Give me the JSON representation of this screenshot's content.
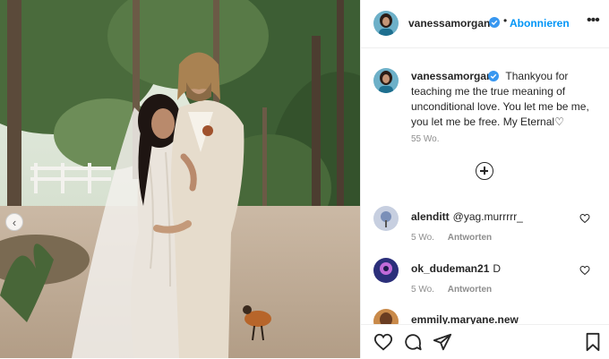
{
  "post": {
    "image_alt": "Wedding photo of a couple in a tropical garden",
    "prev_arrow": "‹"
  },
  "header": {
    "username": "vanessamorgan",
    "separator": "•",
    "follow_label": "Abonnieren",
    "more_label": "•••"
  },
  "caption": {
    "username": "vanessamorgan",
    "text": "Thankyou for teaching me the true meaning of unconditional love. You let me be me, you let me be free. My Eternal♡",
    "age": "55 Wo."
  },
  "comments": [
    {
      "username": "alenditt",
      "text": "@yag.murrrrr_",
      "age": "5 Wo.",
      "reply": "Antworten"
    },
    {
      "username": "ok_dudeman21",
      "text": "D",
      "age": "5 Wo.",
      "reply": "Antworten"
    },
    {
      "username": "emmily.maryane.new",
      "text": "",
      "age": "",
      "reply": ""
    }
  ],
  "colors": {
    "accent": "#0095f6",
    "text": "#262626",
    "muted": "#8e8e8e",
    "verified": "#3897f0"
  },
  "icons": {
    "like": "heart-icon",
    "comment": "comment-icon",
    "share": "paper-plane-icon",
    "save": "bookmark-icon",
    "load_more": "plus-circle-icon"
  }
}
